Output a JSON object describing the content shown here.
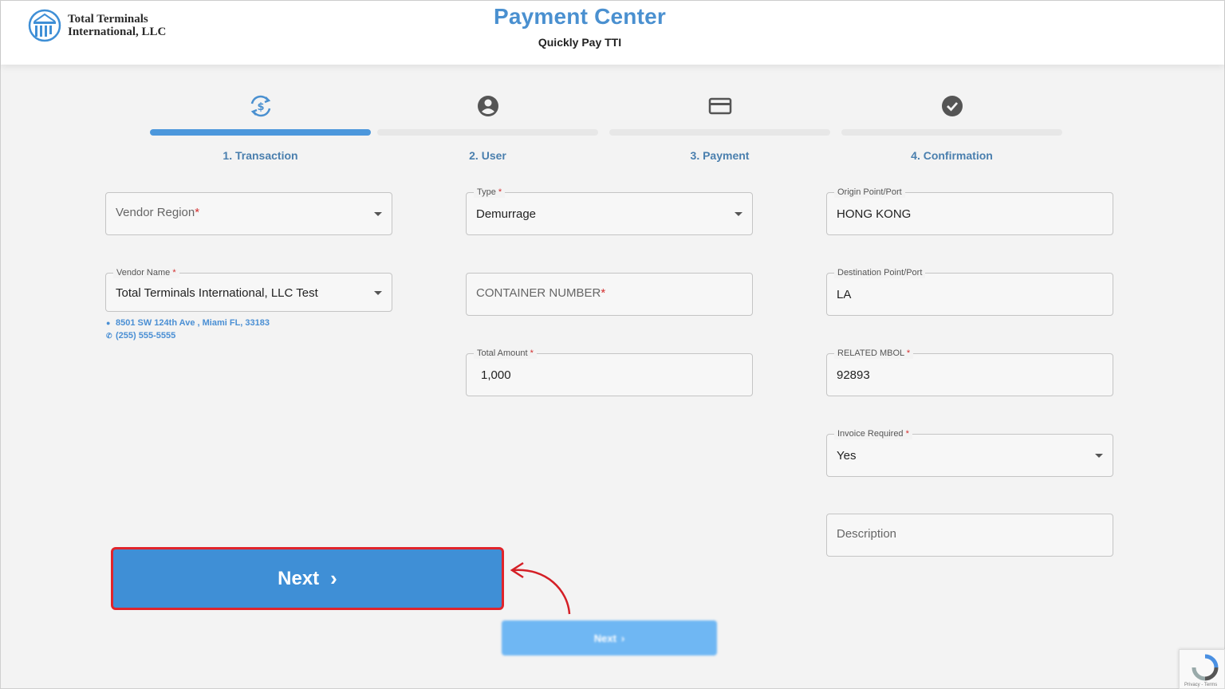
{
  "header": {
    "logo_line1": "Total Terminals",
    "logo_line2": "International, LLC",
    "title": "Payment Center",
    "subtitle": "Quickly Pay TTI"
  },
  "steps": [
    {
      "label": "1. Transaction",
      "icon": "currency-exchange-icon",
      "active": true
    },
    {
      "label": "2. User",
      "icon": "account-circle-icon",
      "active": false
    },
    {
      "label": "3. Payment",
      "icon": "credit-card-icon",
      "active": false
    },
    {
      "label": "4. Confirmation",
      "icon": "check-circle-icon",
      "active": false
    }
  ],
  "form": {
    "vendor_region": {
      "placeholder": "Vendor Region",
      "required_mark": "*"
    },
    "vendor_name": {
      "label": "Vendor Name",
      "required_mark": "*",
      "value": "Total Terminals International, LLC Test"
    },
    "vendor_address": "8501 SW 124th Ave , Miami FL, 33183",
    "vendor_phone": "(255) 555-5555",
    "type": {
      "label": "Type",
      "required_mark": "*",
      "value": "Demurrage"
    },
    "container_number": {
      "placeholder": "CONTAINER NUMBER",
      "required_mark": "*"
    },
    "total_amount": {
      "label": "Total Amount",
      "required_mark": "*",
      "value": "1,000"
    },
    "origin": {
      "label": "Origin Point/Port",
      "value": "HONG KONG"
    },
    "destination": {
      "label": "Destination Point/Port",
      "value": "LA"
    },
    "related_mbol": {
      "label": "RELATED MBOL",
      "required_mark": "*",
      "value": "92893"
    },
    "invoice_required": {
      "label": "Invoice Required",
      "required_mark": "*",
      "value": "Yes"
    },
    "description": {
      "placeholder": "Description"
    }
  },
  "buttons": {
    "next_highlight_label": "Next",
    "next_label": "Next"
  },
  "recaptcha": {
    "text": "Privacy - Terms"
  },
  "colors": {
    "primary": "#4a90d0",
    "active_step": "#4c97dc",
    "highlight_border": "#e0242b",
    "required": "#d32f2f"
  }
}
